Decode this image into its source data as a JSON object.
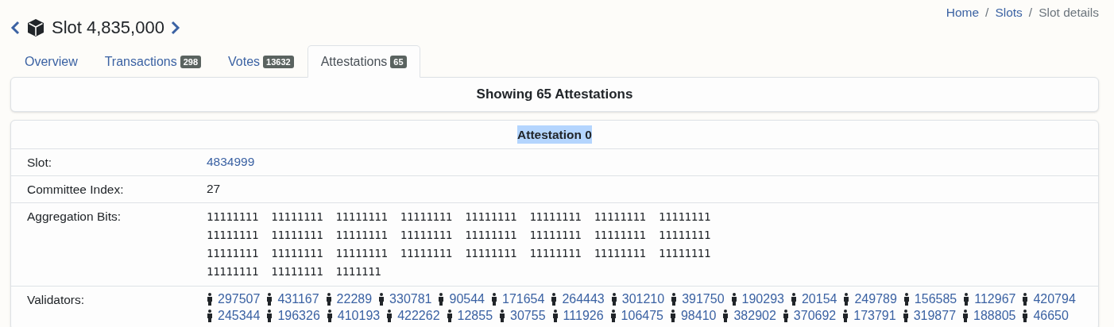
{
  "header": {
    "title": "Slot 4,835,000"
  },
  "breadcrumb_separator": "/",
  "breadcrumb": [
    {
      "label": "Home",
      "kind": "link"
    },
    {
      "label": "Slots",
      "kind": "link"
    },
    {
      "label": "Slot details",
      "kind": "current"
    }
  ],
  "tabs": [
    {
      "label": "Overview",
      "selected": false
    },
    {
      "label": "Transactions",
      "count": "298",
      "selected": false
    },
    {
      "label": "Votes",
      "count": "13632",
      "selected": false
    },
    {
      "label": "Attestations",
      "count": "65",
      "selected": true
    }
  ],
  "summary": "Showing 65 Attestations",
  "attestation": {
    "title": "Attestation 0",
    "highlighted": true,
    "rows": [
      {
        "label": "Slot:",
        "kind": "link",
        "value": "4834999"
      },
      {
        "label": "Committee Index:",
        "kind": "text",
        "value": "27"
      },
      {
        "label": "Aggregation Bits:",
        "kind": "bits",
        "lines": [
          "11111111  11111111  11111111  11111111  11111111  11111111  11111111  11111111",
          "11111111  11111111  11111111  11111111  11111111  11111111  11111111  11111111",
          "11111111  11111111  11111111  11111111  11111111  11111111  11111111  11111111",
          "11111111  11111111  1111111"
        ]
      },
      {
        "label": "Validators:",
        "kind": "validators",
        "lines": [
          [
            "297507",
            "431167",
            "22289",
            "330781",
            "90544",
            "171654",
            "264443",
            "301210",
            "391750",
            "190293",
            "20154",
            "249789",
            "156585",
            "112967",
            "420794"
          ],
          [
            "245344",
            "196326",
            "410193",
            "422262",
            "12855",
            "30755",
            "111926",
            "106475",
            "98410",
            "382902",
            "370692",
            "173791",
            "319877",
            "188805",
            "46650"
          ]
        ]
      }
    ]
  }
}
